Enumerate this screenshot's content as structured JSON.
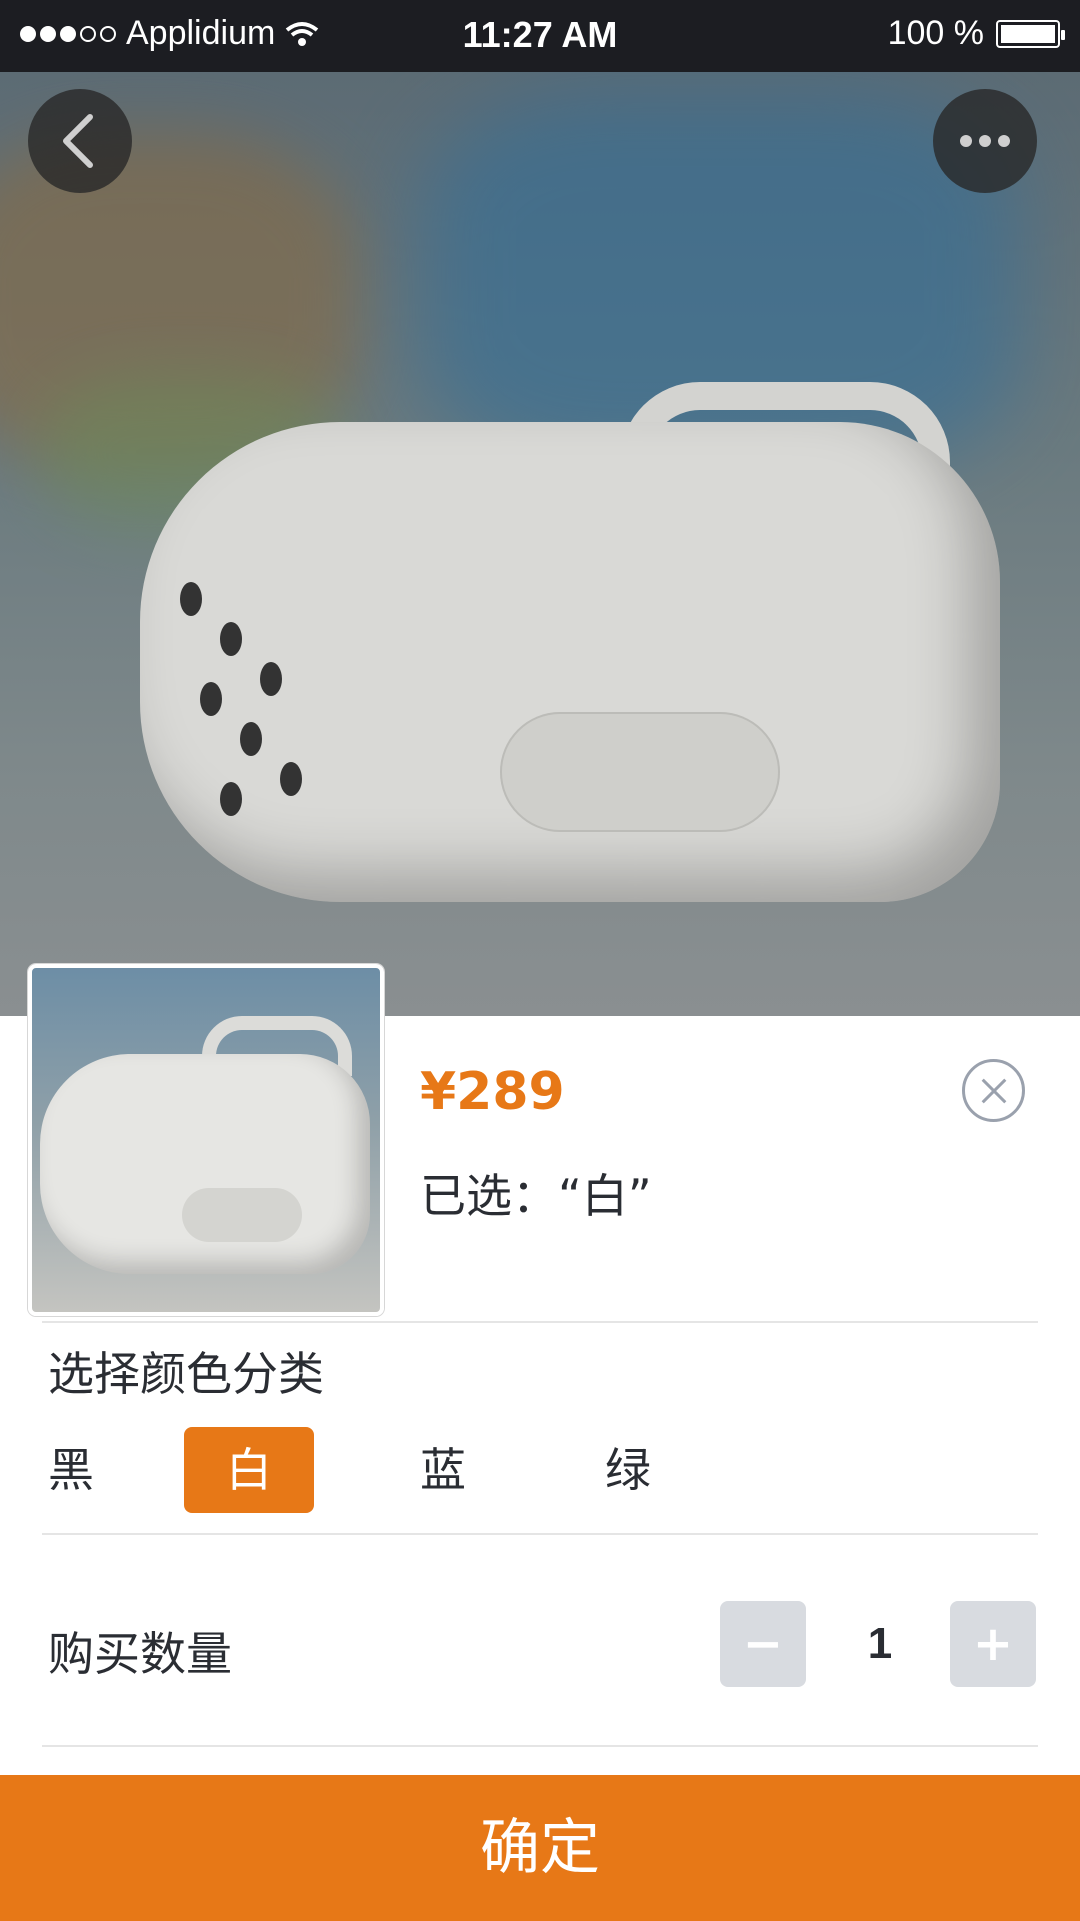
{
  "status_bar": {
    "carrier": "Applidium",
    "time": "11:27 AM",
    "battery": "100 %",
    "battery_level": 1.0
  },
  "product": {
    "price": "¥289",
    "selected_text": "已选：“白”"
  },
  "color_section": {
    "title": "选择颜色分类",
    "options": [
      "黑",
      "白",
      "蓝",
      "绿"
    ],
    "selected": "白"
  },
  "quantity_section": {
    "title": "购买数量",
    "minus": "−",
    "value": "1",
    "plus": "+"
  },
  "confirm_button": "确定",
  "colors": {
    "accent": "#E77817",
    "text": "#2A2D33",
    "stepper": "#D8DBE0",
    "status_bar": "#1C1D22"
  },
  "icons": {
    "back": "chevron-left-icon",
    "more": "more-horizontal-icon",
    "close": "close-circle-icon",
    "wifi": "wifi-icon"
  }
}
